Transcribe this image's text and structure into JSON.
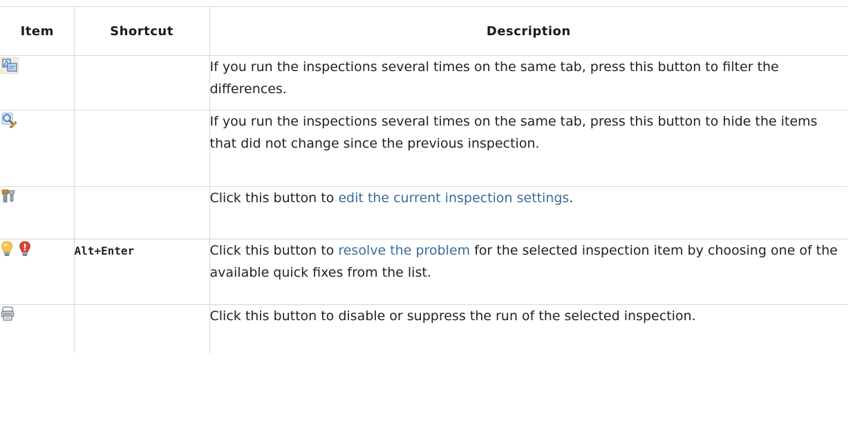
{
  "table": {
    "headers": {
      "item": "Item",
      "shortcut": "Shortcut",
      "description": "Description"
    },
    "rows": [
      {
        "icons": [
          "filter-differences-icon"
        ],
        "shortcut": "",
        "description": "If you run the inspections several times on the same tab, press this button to filter the differences."
      },
      {
        "icons": [
          "hide-unchanged-items-icon"
        ],
        "shortcut": "",
        "description": "If you run the inspections several times on the same tab, press this button to hide the items that did not change since the previous inspection."
      },
      {
        "icons": [
          "edit-settings-icon"
        ],
        "shortcut": "",
        "description_before": "Click this button to ",
        "link": "edit the current inspection settings",
        "description_after": "."
      },
      {
        "icons": [
          "quick-fix-bulb-icon",
          "error-bulb-icon"
        ],
        "shortcut": "Alt+Enter",
        "description_before": "Click this button to ",
        "link": "resolve the problem",
        "description_after": " for the selected inspection item by choosing one of the available quick fixes from the list."
      },
      {
        "icons": [
          "suppress-inspection-icon"
        ],
        "shortcut": "",
        "description": "Click this button to disable or suppress the run of the selected inspection."
      }
    ]
  },
  "colors": {
    "link": "#3b6b99",
    "border": "#d6d6d6",
    "text": "#222222"
  }
}
